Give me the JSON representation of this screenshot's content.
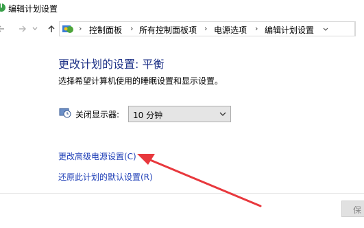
{
  "window": {
    "title": "编辑计划设置"
  },
  "breadcrumb": {
    "items": [
      "控制面板",
      "所有控制面板项",
      "电源选项",
      "编辑计划设置"
    ]
  },
  "main": {
    "heading": "更改计划的设置: 平衡",
    "description": "选择希望计算机使用的睡眠设置和显示设置。",
    "display_off": {
      "label": "关闭显示器:",
      "value": "10 分钟"
    },
    "links": {
      "advanced": "更改高级电源设置(C)",
      "restore": "还原此计划的默认设置(R)"
    }
  },
  "footer": {
    "save_label": "保"
  },
  "colors": {
    "heading": "#1e3287",
    "link": "#1f3fb7",
    "annotation_arrow": "#e8383d"
  },
  "icons": {
    "app": "power-options-icon",
    "back": "back-arrow-icon",
    "forward": "forward-arrow-icon",
    "up": "up-arrow-icon",
    "address": "control-panel-icon",
    "display": "monitor-clock-icon",
    "dropdown": "chevron-down-icon"
  }
}
